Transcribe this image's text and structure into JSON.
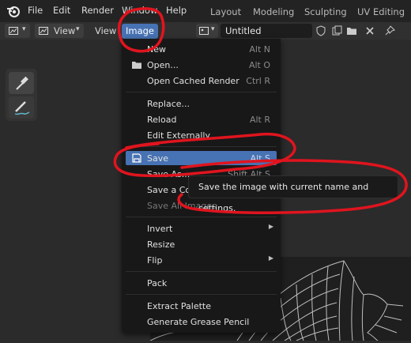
{
  "topbar": {
    "menus": [
      "File",
      "Edit",
      "Render",
      "Window",
      "Help"
    ],
    "workspaces": [
      "Layout",
      "Modeling",
      "Sculpting",
      "UV Editing"
    ]
  },
  "header": {
    "view_label": "View",
    "view2_label": "View",
    "image_menu_label": "Image",
    "image_name": "Untitled"
  },
  "image_menu": {
    "new": {
      "label": "New",
      "shortcut": "Alt N"
    },
    "open": {
      "label": "Open...",
      "shortcut": "Alt O"
    },
    "open_cached": {
      "label": "Open Cached Render",
      "shortcut": "Ctrl R"
    },
    "replace": {
      "label": "Replace..."
    },
    "reload": {
      "label": "Reload",
      "shortcut": "Alt R"
    },
    "edit_externally": {
      "label": "Edit Externally"
    },
    "save": {
      "label": "Save",
      "shortcut": "Alt S"
    },
    "save_as": {
      "label": "Save As...",
      "shortcut": "Shift Alt S"
    },
    "save_copy": {
      "label": "Save a Copy..."
    },
    "save_all": {
      "label": "Save All Images"
    },
    "invert": {
      "label": "Invert"
    },
    "resize": {
      "label": "Resize"
    },
    "flip": {
      "label": "Flip"
    },
    "pack": {
      "label": "Pack"
    },
    "extract_palette": {
      "label": "Extract Palette"
    },
    "generate_gp": {
      "label": "Generate Grease Pencil"
    }
  },
  "tooltip": "Save the image with current name and settings.",
  "colors": {
    "accent": "#4772b3",
    "annotation": "#e0141e"
  }
}
